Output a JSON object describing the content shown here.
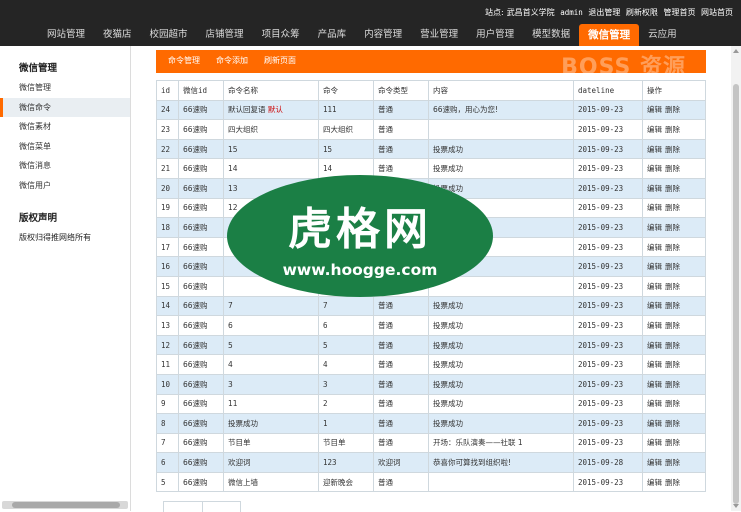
{
  "site": {
    "site_label": "站点:",
    "site_name": "武昌首义学院",
    "user": "admin",
    "logout": "退出管理",
    "refresh": "刷新权限",
    "admin_home": "管理首页",
    "site_home": "网站首页"
  },
  "nav": [
    {
      "label": "网站管理"
    },
    {
      "label": "夜猫店"
    },
    {
      "label": "校园超市"
    },
    {
      "label": "店铺管理"
    },
    {
      "label": "项目众筹"
    },
    {
      "label": "产品库"
    },
    {
      "label": "内容管理"
    },
    {
      "label": "营业管理"
    },
    {
      "label": "用户管理"
    },
    {
      "label": "模型数据"
    },
    {
      "label": "微信管理",
      "active": true
    },
    {
      "label": "云应用"
    }
  ],
  "sidebar": {
    "section_title": "微信管理",
    "items": [
      {
        "label": "微信管理"
      },
      {
        "label": "微信命令",
        "active": true
      },
      {
        "label": "微信素材"
      },
      {
        "label": "微信菜单"
      },
      {
        "label": "微信消息"
      },
      {
        "label": "微信用户"
      }
    ],
    "section2_title": "版权声明",
    "copyright": "版权归得推网络所有"
  },
  "toolbar": {
    "buttons": [
      "命令管理",
      "命令添加",
      "刷新页面"
    ],
    "watermark": "BOSS 资源"
  },
  "table": {
    "headers": [
      "id",
      "微信id",
      "命令名称",
      "命令",
      "命令类型",
      "内容",
      "dateline",
      "操作"
    ],
    "actions": [
      "编辑",
      "删除"
    ],
    "rows": [
      {
        "id": "24",
        "wid": "66速购",
        "name": "默认回复语",
        "tag": "默认",
        "cmd": "111",
        "type": "普通",
        "content": "66速购，用心为您!",
        "date": "2015-09-23"
      },
      {
        "id": "23",
        "wid": "66速购",
        "name": "四大组织",
        "tag": "",
        "cmd": "四大组织",
        "type": "普通",
        "content": "",
        "date": "2015-09-23"
      },
      {
        "id": "22",
        "wid": "66速购",
        "name": "15",
        "tag": "",
        "cmd": "15",
        "type": "普通",
        "content": "投票成功",
        "date": "2015-09-23"
      },
      {
        "id": "21",
        "wid": "66速购",
        "name": "14",
        "tag": "",
        "cmd": "14",
        "type": "普通",
        "content": "投票成功",
        "date": "2015-09-23"
      },
      {
        "id": "20",
        "wid": "66速购",
        "name": "13",
        "tag": "",
        "cmd": "13",
        "type": "普通",
        "content": "投票成功",
        "date": "2015-09-23"
      },
      {
        "id": "19",
        "wid": "66速购",
        "name": "12",
        "tag": "",
        "cmd": "",
        "type": "",
        "content": "投票成功",
        "date": "2015-09-23"
      },
      {
        "id": "18",
        "wid": "66速购",
        "name": "",
        "tag": "",
        "cmd": "",
        "type": "",
        "content": "投票成功",
        "date": "2015-09-23"
      },
      {
        "id": "17",
        "wid": "66速购",
        "name": "",
        "tag": "",
        "cmd": "",
        "type": "",
        "content": "投票成功",
        "date": "2015-09-23"
      },
      {
        "id": "16",
        "wid": "66速购",
        "name": "",
        "tag": "",
        "cmd": "",
        "type": "",
        "content": "投票成功",
        "date": "2015-09-23"
      },
      {
        "id": "15",
        "wid": "66速购",
        "name": "",
        "tag": "",
        "cmd": "",
        "type": "",
        "content": "",
        "date": "2015-09-23"
      },
      {
        "id": "14",
        "wid": "66速购",
        "name": "7",
        "tag": "",
        "cmd": "7",
        "type": "普通",
        "content": "投票成功",
        "date": "2015-09-23"
      },
      {
        "id": "13",
        "wid": "66速购",
        "name": "6",
        "tag": "",
        "cmd": "6",
        "type": "普通",
        "content": "投票成功",
        "date": "2015-09-23"
      },
      {
        "id": "12",
        "wid": "66速购",
        "name": "5",
        "tag": "",
        "cmd": "5",
        "type": "普通",
        "content": "投票成功",
        "date": "2015-09-23"
      },
      {
        "id": "11",
        "wid": "66速购",
        "name": "4",
        "tag": "",
        "cmd": "4",
        "type": "普通",
        "content": "投票成功",
        "date": "2015-09-23"
      },
      {
        "id": "10",
        "wid": "66速购",
        "name": "3",
        "tag": "",
        "cmd": "3",
        "type": "普通",
        "content": "投票成功",
        "date": "2015-09-23"
      },
      {
        "id": "9",
        "wid": "66速购",
        "name": "11",
        "tag": "",
        "cmd": "2",
        "type": "普通",
        "content": "投票成功",
        "date": "2015-09-23"
      },
      {
        "id": "8",
        "wid": "66速购",
        "name": "投票成功",
        "tag": "",
        "cmd": "1",
        "type": "普通",
        "content": "投票成功",
        "date": "2015-09-23"
      },
      {
        "id": "7",
        "wid": "66速购",
        "name": "节目单",
        "tag": "",
        "cmd": "节目单",
        "type": "普通",
        "content": "开场：乐队演奏——社联 1",
        "date": "2015-09-23"
      },
      {
        "id": "6",
        "wid": "66速购",
        "name": "欢迎词",
        "tag": "",
        "cmd": "123",
        "type": "欢迎词",
        "content": "恭喜你可算找到组织啦!",
        "date": "2015-09-28"
      },
      {
        "id": "5",
        "wid": "66速购",
        "name": "微信上墙",
        "tag": "",
        "cmd": "迎新晚会",
        "type": "普通",
        "content": "",
        "date": "2015-09-23"
      }
    ]
  },
  "overlay": {
    "title": "虎格网",
    "url": "www.hoogge.com"
  },
  "colors": {
    "accent": "#ff6a00",
    "header_bg": "#252525",
    "row_alt": "#dcebf7",
    "logo_green": "#1b7f45"
  }
}
